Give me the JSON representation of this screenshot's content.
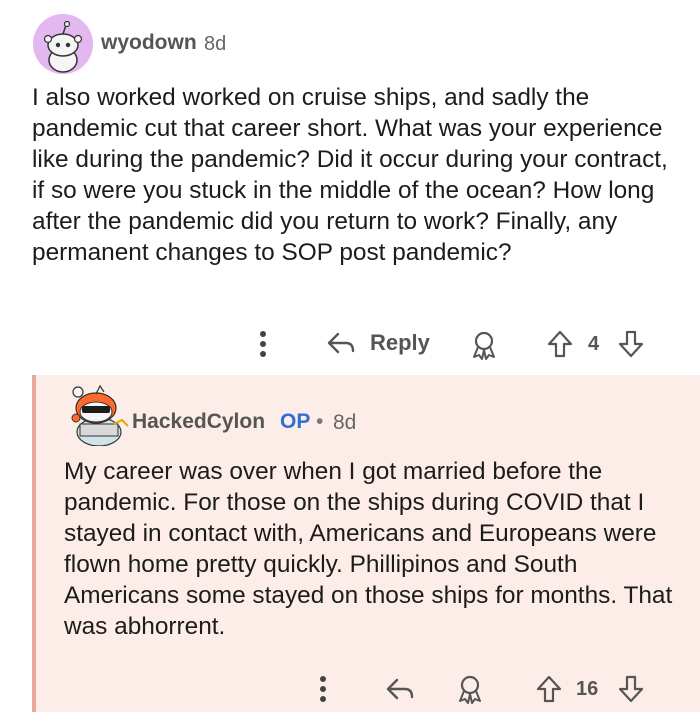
{
  "comment": {
    "author": "wyodown",
    "time": "8d",
    "body": "I also worked worked on cruise ships, and sadly the pandemic cut that career short. What was your experience like during the pandemic? Did it occur during your contract, if so were you stuck in the middle of the ocean? How long after the pandemic did you return to work? Finally, any permanent changes to SOP post pandemic?",
    "reply_label": "Reply",
    "score": "4"
  },
  "reply": {
    "author": "HackedCylon",
    "op_badge": "OP",
    "separator": "•",
    "time": "8d",
    "body": "My career was over when I got married before the pandemic. For those on the ships during COVID that I stayed in contact with, Americans and Europeans were flown home pretty quickly. Phillipinos and South Americans some stayed on those ships for months. That was abhorrent.",
    "score": "16"
  },
  "colors": {
    "reply_background": "#fcede8",
    "thread_line": "#e9a79b",
    "op_blue": "#2f6fd4",
    "avatar_purple": "#e3b7f0"
  },
  "icons": [
    "more-vertical-icon",
    "reply-arrow-icon",
    "award-icon",
    "upvote-icon",
    "downvote-icon"
  ]
}
